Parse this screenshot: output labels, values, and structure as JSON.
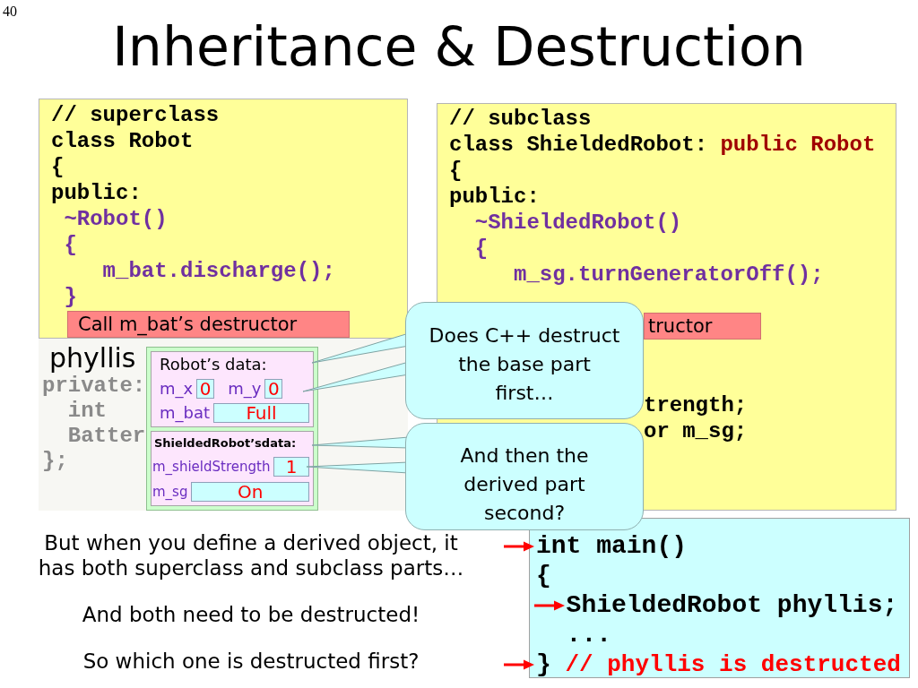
{
  "slide_number": "40",
  "title": "Inheritance & Destruction",
  "superclass_code": {
    "lines": [
      {
        "text": "// superclass",
        "kind": "plain"
      },
      {
        "text": "class Robot",
        "kind": "plain"
      },
      {
        "text": "{",
        "kind": "plain"
      },
      {
        "text": "public:",
        "kind": "plain",
        "children": [
          {
            "text": "~Robot()",
            "kind": "member"
          },
          {
            "text": "{",
            "kind": "member",
            "children": [
              {
                "text": "m_bat.discharge();",
                "kind": "member"
              }
            ]
          },
          {
            "text": "}",
            "kind": "member"
          }
        ]
      }
    ],
    "note": "Call m_bat’s destructor",
    "faded_lines": [
      {
        "text": "private:",
        "children": [
          {
            "text": "int"
          },
          {
            "text": "Batter"
          }
        ]
      },
      {
        "text": "};"
      }
    ]
  },
  "subclass_code": {
    "lines": [
      {
        "text": "// subclass",
        "kind": "plain"
      },
      {
        "parts": [
          {
            "text": "class ShieldedRobot: ",
            "kind": "plain"
          },
          {
            "text": "public Robot",
            "kind": "base"
          }
        ]
      },
      {
        "text": "{",
        "kind": "plain"
      },
      {
        "text": "public:",
        "kind": "plain",
        "children": [
          {
            "text": "~ShieldedRobot()",
            "kind": "member"
          },
          {
            "text": "{",
            "kind": "member",
            "children": [
              {
                "text": "m_sg.turnGeneratorOff();",
                "kind": "member"
              }
            ]
          }
        ]
      }
    ],
    "note": "tructor",
    "clipped_lines": [
      {
        "text": "trength;",
        "kind": "plain"
      },
      {
        "text": "or m_sg;",
        "kind": "plain"
      }
    ]
  },
  "object": {
    "name": "phyllis",
    "sections": [
      {
        "kind": "base",
        "title": "Robot’s data:",
        "rows": [
          {
            "fields": [
              {
                "name": "m_x",
                "value": "0"
              },
              {
                "name": "m_y",
                "value": "0"
              }
            ]
          },
          {
            "fields": [
              {
                "name": "m_bat",
                "value": "Full"
              }
            ]
          }
        ]
      },
      {
        "kind": "derived",
        "title": "ShieldedRobot’sdata:",
        "rows": [
          {
            "fields": [
              {
                "name": "m_shieldStrength",
                "value": "1"
              }
            ]
          },
          {
            "fields": [
              {
                "name": "m_sg",
                "value": "On"
              }
            ]
          }
        ]
      }
    ]
  },
  "callouts": [
    "Does C++ destruct\nthe base part\nfirst…",
    "And then the\nderived part\nsecond?"
  ],
  "notes": [
    "But when you define a derived object, it\nhas both superclass and subclass parts…",
    "And both need to be destructed!",
    "So which one is destructed first?"
  ],
  "main_code": {
    "lines": [
      {
        "text": "int main()",
        "kind": "plain",
        "arrow": true
      },
      {
        "text": "{",
        "kind": "plain",
        "arrow": false,
        "children": [
          {
            "text": "ShieldedRobot phyllis;",
            "kind": "plain",
            "arrow": true
          },
          {
            "text": "...",
            "kind": "plain",
            "arrow": false
          }
        ]
      },
      {
        "parts": [
          {
            "text": "}",
            "kind": "plain"
          },
          {
            "text": " // phyllis is destructed",
            "kind": "comment"
          }
        ],
        "arrow": true
      }
    ]
  }
}
